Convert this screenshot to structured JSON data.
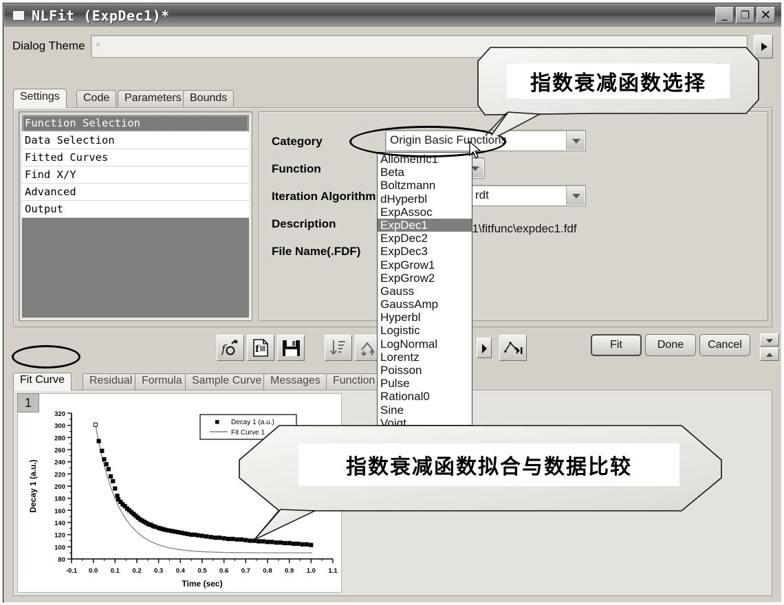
{
  "window": {
    "title": "NLFit (ExpDec1)*",
    "controls": {
      "minimize": "_",
      "maximize": "▣",
      "close": "✕"
    }
  },
  "theme_bar": {
    "label": "Dialog Theme",
    "combo_value": "×",
    "play_button": "play-arrow"
  },
  "tabs": [
    {
      "label": "Settings",
      "active": true
    },
    {
      "label": "Code",
      "active": false
    },
    {
      "label": "Parameters",
      "active": false
    },
    {
      "label": "Bounds",
      "active": false
    }
  ],
  "sidebar": {
    "items": [
      {
        "label": "Function Selection",
        "selected": true
      },
      {
        "label": "Data Selection",
        "selected": false
      },
      {
        "label": "Fitted Curves",
        "selected": false
      },
      {
        "label": "Find X/Y",
        "selected": false
      },
      {
        "label": "Advanced",
        "selected": false
      },
      {
        "label": "Output",
        "selected": false
      }
    ]
  },
  "form": {
    "category_label": "Category",
    "category_value": "Origin Basic Functions",
    "function_label": "Function",
    "function_value": "ExpDec1",
    "iteration_label": "Iteration Algorithm",
    "iteration_value": "rdt",
    "description_label": "Description",
    "filename_label": "File Name(.FDF)",
    "filename_value": "81\\fitfunc\\expdec1.fdf"
  },
  "function_dropdown": {
    "selected": "ExpDec1",
    "options": [
      "Allometric1",
      "Beta",
      "Boltzmann",
      "dHyperbl",
      "ExpAssoc",
      "ExpDec1",
      "ExpDec2",
      "ExpDec3",
      "ExpGrow1",
      "ExpGrow2",
      "Gauss",
      "GaussAmp",
      "Hyperbl",
      "Logistic",
      "LogNormal",
      "Lorentz",
      "Poisson",
      "Pulse",
      "Rational0",
      "Sine",
      "Voigt"
    ]
  },
  "toolbar": {
    "icons": [
      {
        "name": "function-edit-icon"
      },
      {
        "name": "function-file-icon"
      },
      {
        "name": "save-icon"
      },
      {
        "name": "initialize-params-icon"
      },
      {
        "name": "fit-one-iteration-icon"
      },
      {
        "name": "next-step-icon"
      }
    ],
    "step_arrow": "▶"
  },
  "actions": {
    "fit": "Fit",
    "done": "Done",
    "cancel": "Cancel"
  },
  "bottom_tabs": [
    {
      "label": "Fit Curve",
      "active": true
    },
    {
      "label": "Residual",
      "active": false
    },
    {
      "label": "Formula",
      "active": false
    },
    {
      "label": "Sample Curve",
      "active": false
    },
    {
      "label": "Messages",
      "active": false
    },
    {
      "label": "Function Fi",
      "active": false
    }
  ],
  "graph": {
    "sheet_tab": "1"
  },
  "callouts": [
    {
      "text": "指数衰减函数选择"
    },
    {
      "text": "指数衰减函数拟合与数据比较"
    }
  ],
  "chart_data": {
    "type": "scatter",
    "title": "",
    "xlabel": "Time (sec)",
    "ylabel": "Decay 1 (a.u.)",
    "xlim": [
      -0.1,
      1.1
    ],
    "ylim": [
      80,
      320
    ],
    "xticks": [
      -0.1,
      0.0,
      0.1,
      0.2,
      0.3,
      0.4,
      0.5,
      0.6,
      0.7,
      0.8,
      0.9,
      1.0,
      1.1
    ],
    "xticklabels": [
      "-0.1",
      "0.0",
      "0.1",
      "0.2",
      "0.3",
      "0.4",
      "0.5",
      "0.6",
      "0.7",
      "0.8",
      "0.9",
      "1.0",
      "1.1"
    ],
    "yticks": [
      80,
      100,
      120,
      140,
      160,
      180,
      200,
      220,
      240,
      260,
      280,
      300,
      320
    ],
    "yticklabels": [
      "80",
      "100",
      "120",
      "140",
      "160",
      "180",
      "200",
      "220",
      "240",
      "260",
      "280",
      "300",
      "320"
    ],
    "grid": false,
    "legend_position": "top-right",
    "legend": [
      {
        "name": "Decay 1 (a.u.)",
        "marker": "square",
        "color": "#000000"
      },
      {
        "name": "Fit Curve 1",
        "marker": "line",
        "color": "#808080"
      }
    ],
    "series": [
      {
        "name": "Decay 1 (a.u.)",
        "type": "scatter",
        "marker": "square",
        "color": "#000000",
        "x": [
          0.01,
          0.025,
          0.04,
          0.05,
          0.06,
          0.07,
          0.08,
          0.09,
          0.1,
          0.11,
          0.115,
          0.125,
          0.135,
          0.145,
          0.155,
          0.165,
          0.175,
          0.185,
          0.195,
          0.205,
          0.215,
          0.225,
          0.235,
          0.245,
          0.255,
          0.265,
          0.275,
          0.285,
          0.3,
          0.31,
          0.32,
          0.33,
          0.345,
          0.36,
          0.375,
          0.39,
          0.405,
          0.42,
          0.435,
          0.45,
          0.465,
          0.48,
          0.5,
          0.52,
          0.54,
          0.56,
          0.58,
          0.6,
          0.62,
          0.64,
          0.66,
          0.68,
          0.7,
          0.72,
          0.74,
          0.76,
          0.78,
          0.8,
          0.82,
          0.84,
          0.86,
          0.88,
          0.9,
          0.92,
          0.94,
          0.96,
          0.98,
          1.0
        ],
        "y": [
          301,
          274,
          258,
          244,
          236,
          228,
          216,
          208,
          196,
          184,
          178,
          174,
          170,
          167,
          163,
          160,
          157,
          154,
          151,
          148,
          145,
          143,
          141,
          139,
          137,
          136,
          134,
          133,
          131,
          130,
          129,
          128,
          127,
          126,
          125,
          124,
          123,
          122,
          121,
          120,
          120,
          119,
          118,
          117,
          116,
          115,
          115,
          114,
          113,
          113,
          112,
          112,
          111,
          110,
          110,
          109,
          109,
          108,
          108,
          107,
          107,
          106,
          106,
          105,
          105,
          104,
          104,
          103
        ]
      },
      {
        "name": "Fit Curve 1",
        "type": "line",
        "color": "#808080",
        "model": "y = 100 + 215*exp(-x/0.115)",
        "x": [
          0.01,
          0.05,
          0.1,
          0.15,
          0.2,
          0.25,
          0.3,
          0.35,
          0.4,
          0.45,
          0.5,
          0.55,
          0.6,
          0.65,
          0.7,
          0.75,
          0.8,
          0.85,
          0.9,
          0.95,
          1.0
        ],
        "y": [
          298,
          240,
          191,
          157,
          135,
          120,
          110,
          103,
          99,
          96,
          94,
          93,
          92,
          91,
          91,
          90,
          90,
          90,
          90,
          90,
          90
        ]
      }
    ]
  }
}
